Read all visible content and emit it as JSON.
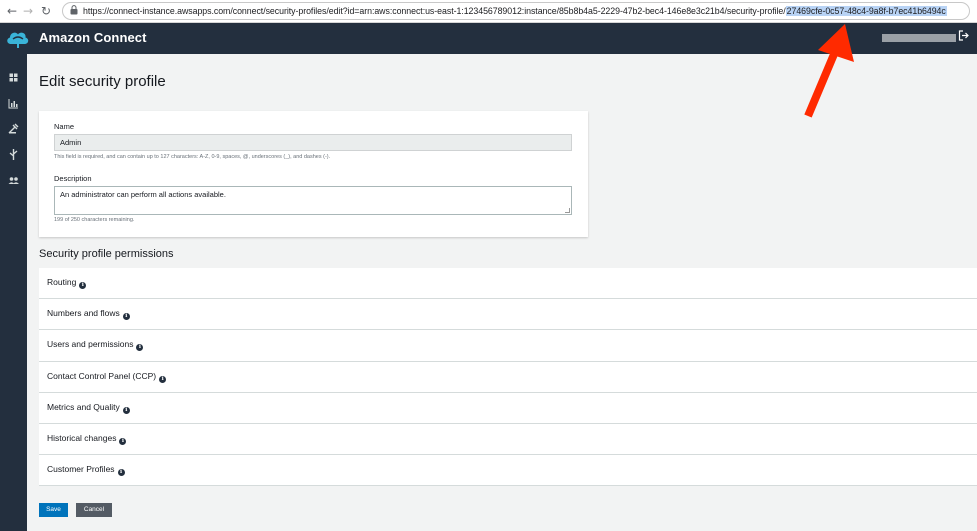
{
  "browser": {
    "url_base": "https://connect-instance.awsapps.com/connect/security-profiles/edit?id=arn:aws:connect:us-east-1:123456789012:instance/85b8b4a5-2229-47b2-bec4-146e8e3c21b4/security-profile/",
    "url_selected": "27469cfe-0c57-48c4-9a8f-b7ec41b6494c"
  },
  "header": {
    "title": "Amazon Connect"
  },
  "page": {
    "title": "Edit security profile"
  },
  "form": {
    "name_label": "Name",
    "name_value": "Admin",
    "name_hint": "This field is required, and can contain up to 127 characters: A-Z, 0-9, spaces, @, underscores (_), and dashes (-).",
    "description_label": "Description",
    "description_value": "An administrator can perform all actions available.",
    "description_hint": "199 of 250 characters remaining."
  },
  "permissions": {
    "title": "Security profile permissions",
    "sections": [
      {
        "label": "Routing"
      },
      {
        "label": "Numbers and flows"
      },
      {
        "label": "Users and permissions"
      },
      {
        "label": "Contact Control Panel (CCP)"
      },
      {
        "label": "Metrics and Quality"
      },
      {
        "label": "Historical changes"
      },
      {
        "label": "Customer Profiles"
      }
    ]
  },
  "actions": {
    "save_label": "Save",
    "cancel_label": "Cancel"
  },
  "colors": {
    "header_bg": "#232f3e",
    "primary_button": "#0073bb",
    "secondary_button": "#545b64",
    "annotation_arrow": "#ff2a00",
    "url_highlight": "#b8d3f5"
  }
}
